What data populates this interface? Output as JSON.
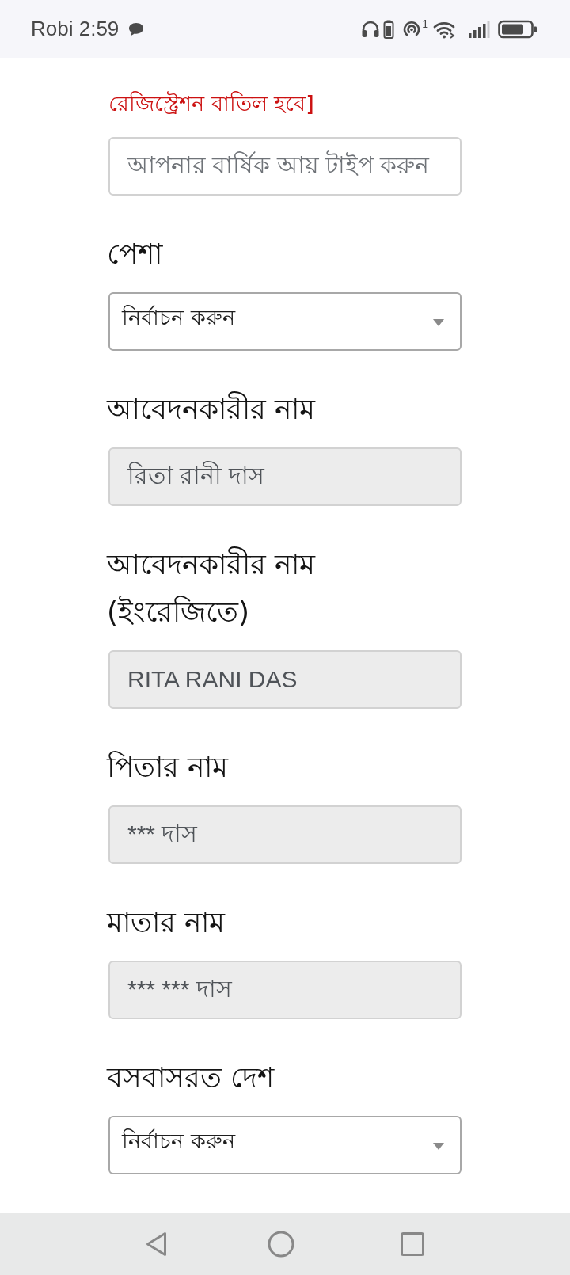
{
  "status_bar": {
    "carrier_time": "Robi 2:59",
    "hotspot_count": "1"
  },
  "income_note": "রেজিস্ট্রেশন বাতিল হবে]",
  "fields": [
    {
      "kind": "input",
      "placeholder": "আপনার বার্ষিক আয় টাইপ করুন",
      "disabled": false
    },
    {
      "kind": "select",
      "label": "পেশা",
      "value": "নির্বাচন করুন",
      "disabled": false
    },
    {
      "kind": "input",
      "label": "আবেদনকারীর নাম",
      "value": "রিতা রানী দাস",
      "disabled": true
    },
    {
      "kind": "input",
      "label": "আবেদনকারীর নাম (ইংরেজিতে)",
      "value": "RITA RANI DAS",
      "disabled": true
    },
    {
      "kind": "input",
      "label": "পিতার নাম",
      "value": "*** দাস",
      "disabled": true
    },
    {
      "kind": "input",
      "label": "মাতার নাম",
      "value": "*** *** দাস",
      "disabled": true
    },
    {
      "kind": "select",
      "label": "বসবাসরত দেশ",
      "value": "নির্বাচন করুন",
      "disabled": false
    }
  ]
}
